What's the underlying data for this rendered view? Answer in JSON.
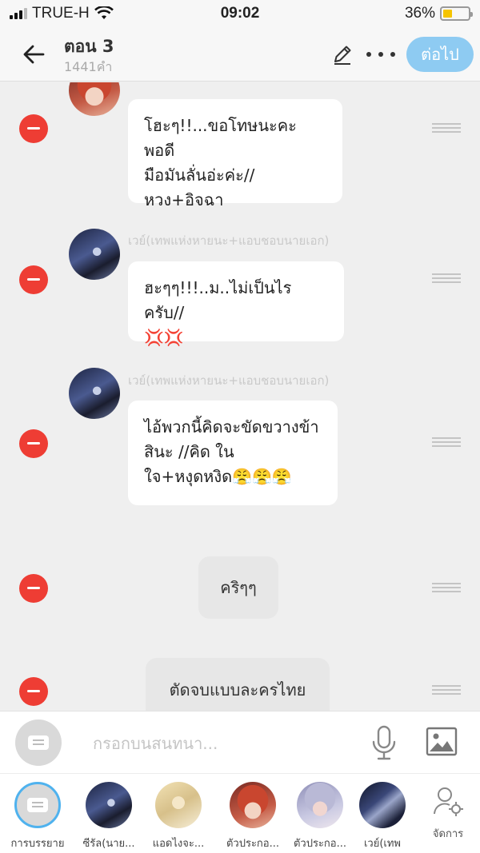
{
  "status_bar": {
    "carrier": "TRUE-H",
    "time": "09:02",
    "battery": "36%",
    "battery_level": 0.36,
    "signal_bars": 3
  },
  "header": {
    "title": "ตอน 3",
    "subtitle": "1441คำ",
    "next_label": "ต่อไป"
  },
  "messages": [
    {
      "type": "character",
      "sender": "",
      "avatar": "red-hair-character",
      "lines": [
        "โฮะๆ!!...ขอโทษนะคะพอดี",
        "มือมันลั่นอ่ะค่ะ//",
        "หวง+อิจฉา"
      ]
    },
    {
      "type": "character",
      "sender": "เวย์(เทพแห่งหายนะ+แอบชอบนายเอก)",
      "avatar": "dark-cloaked-character",
      "lines": [
        "ฮะๆๆ!!!..ม..ไม่เป็นไรครับ//",
        "💢💢"
      ]
    },
    {
      "type": "character",
      "sender": "เวย์(เทพแห่งหายนะ+แอบชอบนายเอก)",
      "avatar": "dark-cloaked-character",
      "lines": [
        "ไอ้พวกนี้คิดจะขัดขวางข้า",
        "สินะ //คิด ใน",
        "ใจ+หงุดหงิด😤😤😤"
      ]
    },
    {
      "type": "narration",
      "text": "คริๆๆ"
    },
    {
      "type": "narration",
      "text": "ตัดจบแบบละครไทย"
    }
  ],
  "input": {
    "placeholder": "กรอกบนสนทนา..."
  },
  "characters": [
    {
      "label": "การบรรยาย",
      "avatar": "narration"
    },
    {
      "label": "ซีรัล(นาย...",
      "avatar": "dark-haired"
    },
    {
      "label": "แอดไงจะ...",
      "avatar": "blond"
    },
    {
      "label": "ตัวประกอ...",
      "avatar": "red-hair"
    },
    {
      "label": "ตัวประกอ...",
      "avatar": "silver-hair"
    },
    {
      "label": "เวย์(เทพ",
      "avatar": "dark-cloaked"
    }
  ],
  "manage_label": "จัดการ",
  "colors": {
    "accent": "#4fb2ee",
    "next_button": "#8ecbf2",
    "delete": "#ee3d34",
    "battery": "#f5c400"
  },
  "icons": [
    "back-arrow-icon",
    "pencil-icon",
    "more-icon",
    "delete-icon",
    "drag-handle-icon",
    "microphone-icon",
    "image-icon",
    "manage-user-icon"
  ]
}
